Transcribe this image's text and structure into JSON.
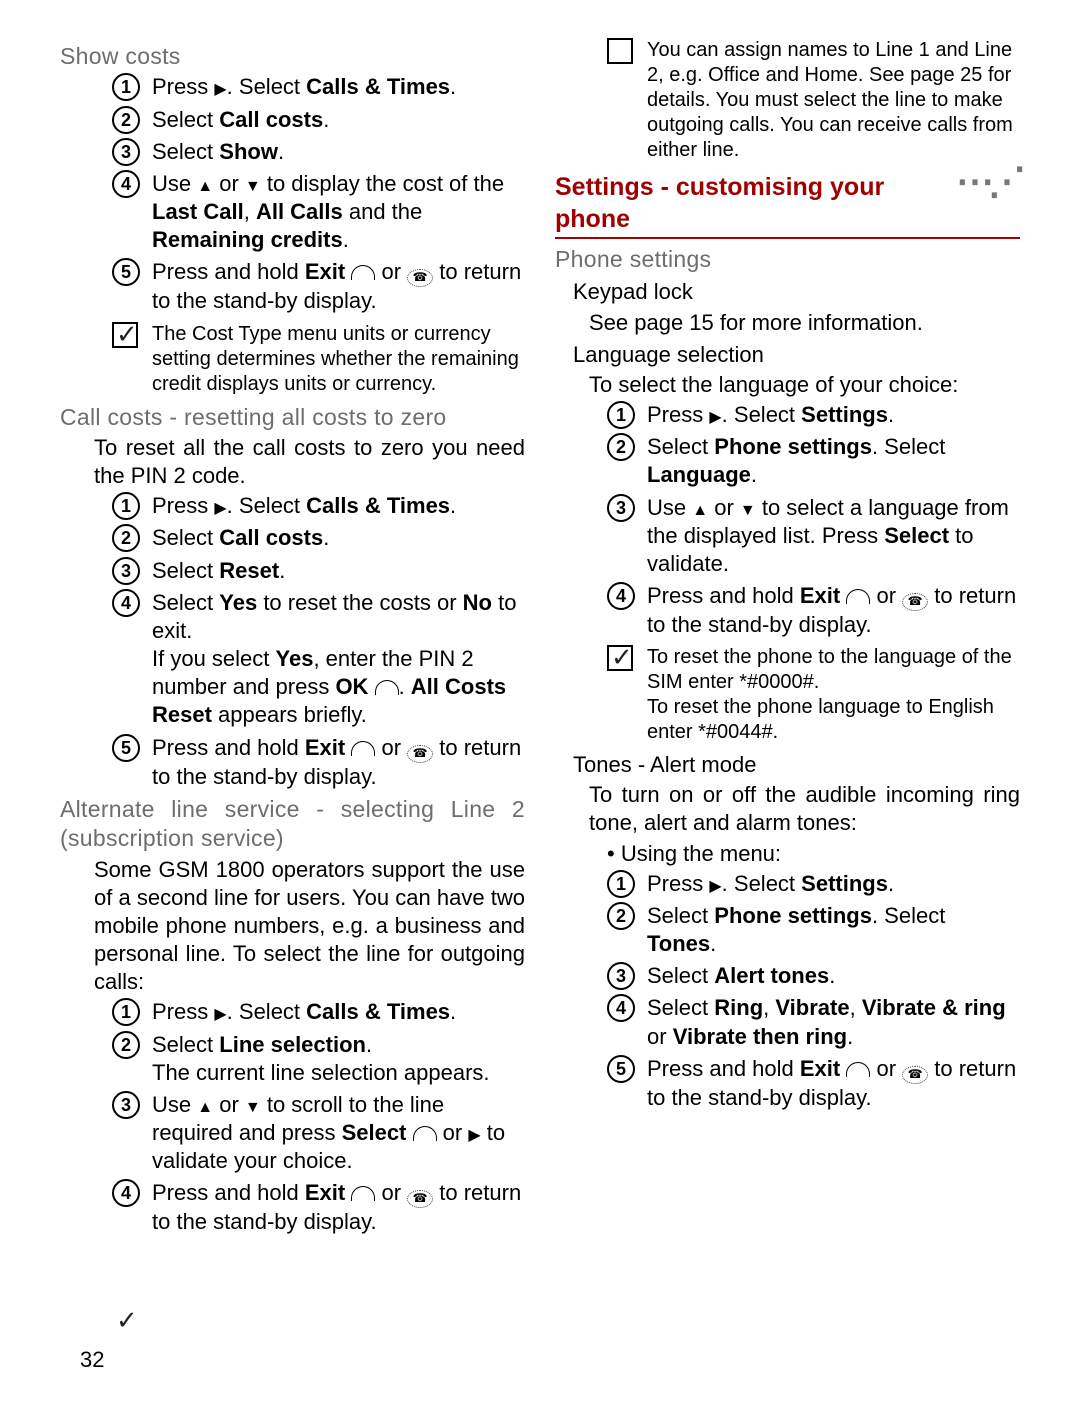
{
  "page_number": "32",
  "left": {
    "show_costs": {
      "title": "Show costs",
      "steps": [
        {
          "pre": "Press ",
          "icon": "right",
          "post": ". Select ",
          "bold": "Calls & Times",
          "tail": "."
        },
        {
          "pre": "Select ",
          "bold": "Call costs",
          "tail": "."
        },
        {
          "pre": "Select ",
          "bold": "Show",
          "tail": "."
        },
        {
          "raw_parts": [
            "Use ",
            "up",
            " or ",
            "down",
            " to display the cost of the ",
            "b:Last Call",
            ", ",
            "b:All Calls",
            " and the ",
            "b:Remaining credits",
            "."
          ]
        },
        {
          "raw_parts": [
            "Press and hold ",
            "b:Exit",
            " ",
            "arc",
            " or ",
            "oval",
            " to return to the stand-by display."
          ]
        }
      ],
      "note": "The Cost Type menu units or currency setting determines whether the remaining credit displays units or currency."
    },
    "reset": {
      "title": "Call costs - resetting all costs to zero",
      "intro": "To reset all the call costs to zero you need the PIN 2 code.",
      "steps": [
        {
          "pre": "Press ",
          "icon": "right",
          "post": ". Select ",
          "bold": "Calls & Times",
          "tail": "."
        },
        {
          "pre": "Select ",
          "bold": "Call costs",
          "tail": "."
        },
        {
          "pre": "Select ",
          "bold": "Reset",
          "tail": "."
        },
        {
          "raw_parts": [
            "Select ",
            "b:Yes",
            " to reset the costs or ",
            "b:No",
            " to exit.\nIf you select ",
            "b:Yes",
            ", enter the PIN 2 number and press ",
            "b:OK",
            " ",
            "arc",
            ". ",
            "b:All Costs Reset",
            " appears briefly."
          ]
        },
        {
          "raw_parts": [
            "Press and hold ",
            "b:Exit",
            " ",
            "arc",
            " or ",
            "oval",
            " to return to the stand-by display."
          ]
        }
      ]
    },
    "altline": {
      "title": "Alternate line service - selecting Line 2 (subscription service)",
      "intro": "Some GSM 1800 operators support the use of a second line for users. You can have two mobile phone numbers, e.g. a business and personal line. To select the line for outgoing calls:",
      "steps": [
        {
          "pre": "Press ",
          "icon": "right",
          "post": ". Select ",
          "bold": "Calls & Times",
          "tail": "."
        },
        {
          "raw_parts": [
            "Select ",
            "b:Line selection",
            ".\nThe current line selection appears."
          ]
        },
        {
          "raw_parts": [
            "Use ",
            "up",
            " or ",
            "down",
            " to scroll to the line required and press ",
            "b:Select",
            " ",
            "arc",
            " or ",
            "right",
            " to validate your choice."
          ]
        }
      ]
    }
  },
  "right": {
    "altline_cont": {
      "steps": [
        {
          "num": "4",
          "raw_parts": [
            "Press and hold ",
            "b:Exit",
            " ",
            "arc",
            " or ",
            "oval",
            " to return to the stand-by display."
          ]
        }
      ],
      "note": "You can assign names to Line 1 and Line 2, e.g. Office and Home. See page 25 for details. You must select the line to make outgoing calls. You can receive calls from either line."
    },
    "settings_heading": "Settings - customising your phone",
    "phone_settings": {
      "title": "Phone settings",
      "keypad": {
        "title": "Keypad lock",
        "body": "See page 15 for more information."
      },
      "lang": {
        "title": "Language selection",
        "intro": "To select the language of your choice:",
        "steps": [
          {
            "pre": "Press ",
            "icon": "right",
            "post": ". Select ",
            "bold": "Settings",
            "tail": "."
          },
          {
            "raw_parts": [
              "Select ",
              "b:Phone settings",
              ". Select ",
              "b:Language",
              "."
            ]
          },
          {
            "raw_parts": [
              "Use ",
              "up",
              " or ",
              "down",
              " to select a language from the displayed list. Press ",
              "b:Select",
              " to validate."
            ]
          },
          {
            "raw_parts": [
              "Press and hold ",
              "b:Exit",
              " ",
              "arc",
              " or ",
              "oval",
              " to return to the stand-by display."
            ]
          }
        ],
        "note": "To reset the phone to the language of the SIM enter *#0000#.\nTo reset the phone language to English enter *#0044#."
      },
      "tones": {
        "title": "Tones - Alert mode",
        "intro": "To turn on or off the audible incoming ring tone, alert and alarm tones:",
        "bullet": "Using the menu:",
        "steps": [
          {
            "pre": "Press ",
            "icon": "right",
            "post": ". Select ",
            "bold": "Settings",
            "tail": "."
          },
          {
            "raw_parts": [
              "Select ",
              "b:Phone settings",
              ". Select ",
              "b:Tones",
              "."
            ]
          },
          {
            "pre": "Select ",
            "bold": "Alert tones",
            "tail": "."
          },
          {
            "raw_parts": [
              "Select ",
              "b:Ring",
              ", ",
              "b:Vibrate",
              ", ",
              "b:Vibrate & ring",
              " or ",
              "b:Vibrate then ring",
              "."
            ]
          },
          {
            "raw_parts": [
              "Press and hold  ",
              "b:Exit",
              " ",
              "arc",
              " or ",
              "oval",
              " to return to the stand-by display."
            ]
          }
        ]
      }
    }
  }
}
